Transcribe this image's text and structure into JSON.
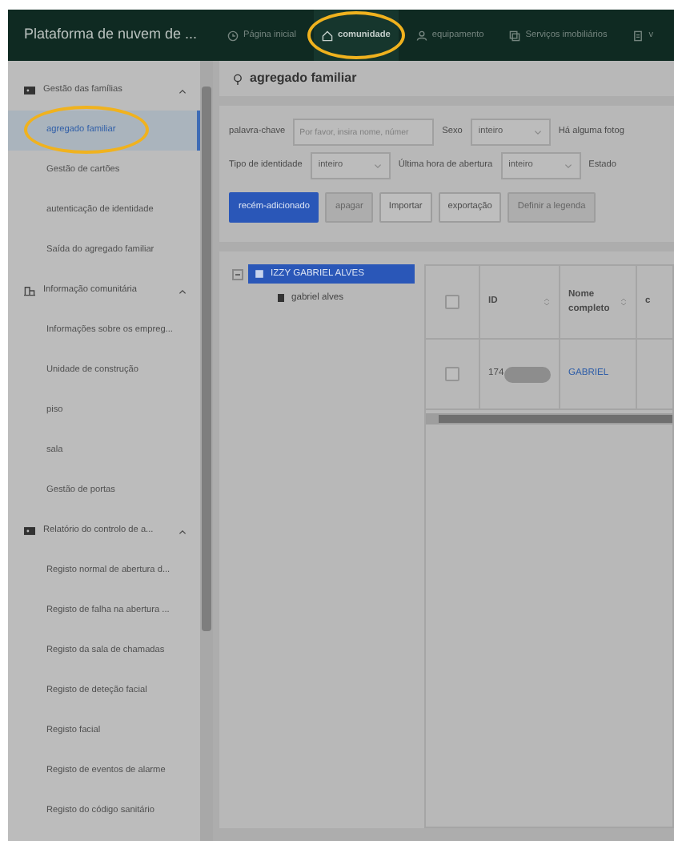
{
  "header": {
    "title": "Plataforma de nuvem de ...",
    "nav": [
      {
        "label": "Página inicial",
        "selected": false,
        "circled": false
      },
      {
        "label": "comunidade",
        "selected": true,
        "circled": true
      },
      {
        "label": "equipamento",
        "selected": false,
        "circled": false
      },
      {
        "label": "Serviços imobiliários",
        "selected": false,
        "circled": false
      },
      {
        "label": "v",
        "selected": false,
        "circled": false
      }
    ]
  },
  "sidebar": {
    "groups": [
      {
        "label": "Gestão das famílias",
        "expanded": true,
        "children": [
          {
            "label": "agregado familiar",
            "selected": true,
            "circled": true
          },
          {
            "label": "Gestão de cartões",
            "selected": false,
            "circled": false
          },
          {
            "label": "autenticação de identidade",
            "selected": false,
            "circled": false
          },
          {
            "label": "Saída do agregado familiar",
            "selected": false,
            "circled": false
          }
        ]
      },
      {
        "label": "Informação comunitária",
        "expanded": true,
        "children": [
          {
            "label": "Informações sobre os empreg...",
            "selected": false,
            "circled": false
          },
          {
            "label": "Unidade de construção",
            "selected": false,
            "circled": false
          },
          {
            "label": "piso",
            "selected": false,
            "circled": false
          },
          {
            "label": "sala",
            "selected": false,
            "circled": false
          },
          {
            "label": "Gestão de portas",
            "selected": false,
            "circled": false
          }
        ]
      },
      {
        "label": "Relatório do controlo de a...",
        "expanded": true,
        "children": [
          {
            "label": "Registo normal de abertura d...",
            "selected": false,
            "circled": false
          },
          {
            "label": "Registo de falha na abertura ...",
            "selected": false,
            "circled": false
          },
          {
            "label": "Registo da sala de chamadas",
            "selected": false,
            "circled": false
          },
          {
            "label": "Registo de deteção facial",
            "selected": false,
            "circled": false
          },
          {
            "label": "Registo facial",
            "selected": false,
            "circled": false
          },
          {
            "label": "Registo de eventos de alarme",
            "selected": false,
            "circled": false
          },
          {
            "label": "Registo do código sanitário",
            "selected": false,
            "circled": false
          }
        ]
      }
    ]
  },
  "page_title": "agregado familiar",
  "filters": [
    [
      {
        "kind": "label",
        "text": "palavra-chave"
      },
      {
        "kind": "input",
        "placeholder": "Por favor, insira nome, númer"
      },
      {
        "kind": "label",
        "text": "Sexo"
      },
      {
        "kind": "select",
        "value": "inteiro"
      },
      {
        "kind": "label",
        "text": "Há alguma fotog"
      }
    ],
    [
      {
        "kind": "label",
        "text": "Tipo de identidade"
      },
      {
        "kind": "select",
        "value": "inteiro"
      },
      {
        "kind": "label",
        "text": "Última hora de abertura"
      },
      {
        "kind": "select",
        "value": "inteiro"
      },
      {
        "kind": "label",
        "text": "Estado"
      }
    ]
  ],
  "buttons": [
    {
      "label": "recém-adicionado",
      "kind": "primary"
    },
    {
      "label": "apagar",
      "kind": "disabled"
    },
    {
      "label": "Importar",
      "kind": "default"
    },
    {
      "label": "exportação",
      "kind": "default"
    },
    {
      "label": "Definir a legenda",
      "kind": "disabled"
    }
  ],
  "tree": [
    {
      "label": "IZZY GABRIEL ALVES",
      "selected": true,
      "expanded": true,
      "children": [
        {
          "label": "gabriel alves",
          "selected": false
        }
      ]
    }
  ],
  "table": {
    "all_checked": false,
    "columns": [
      {
        "label": "ID",
        "sortable": true
      },
      {
        "label": "Nome completo",
        "sortable": true
      },
      {
        "label": "c"
      }
    ],
    "rows": [
      {
        "checked": false,
        "id": "174",
        "redacted": true,
        "name": "GABRIEL"
      }
    ]
  }
}
